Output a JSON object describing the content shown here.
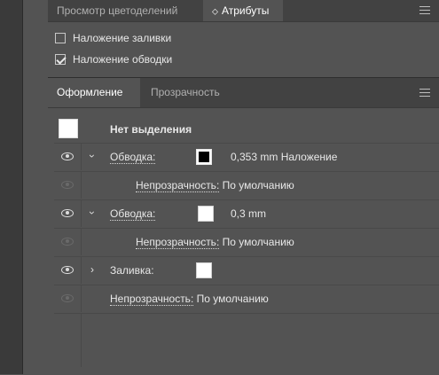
{
  "top_panel": {
    "tabs": [
      {
        "label": "Просмотр цветоделений",
        "active": false
      },
      {
        "label": "Атрибуты",
        "active": true
      }
    ],
    "active_tab_prefix": "⬦",
    "checkboxes": [
      {
        "label": "Наложение заливки",
        "checked": false
      },
      {
        "label": "Наложение обводки",
        "checked": true
      }
    ]
  },
  "appearance_panel": {
    "tabs": [
      {
        "label": "Оформление",
        "active": true
      },
      {
        "label": "Прозрачность",
        "active": false
      }
    ],
    "header": {
      "label": "Нет выделения"
    },
    "rows": [
      {
        "type": "stroke",
        "label": "Обводка:",
        "value": "0,353 mm Наложение",
        "swatch": "black-stroke"
      },
      {
        "type": "opacity",
        "label": "Непрозрачность:",
        "value": "По умолчанию"
      },
      {
        "type": "stroke",
        "label": "Обводка:",
        "value": "0,3 mm",
        "swatch": "white"
      },
      {
        "type": "opacity",
        "label": "Непрозрачность:",
        "value": "По умолчанию"
      },
      {
        "type": "fill",
        "label": "Заливка:",
        "swatch": "white"
      },
      {
        "type": "opacity",
        "label": "Непрозрачность:",
        "value": "По умолчанию"
      }
    ]
  },
  "colors": {
    "panel_bg": "#535353",
    "tabbar_bg": "#424242",
    "text": "#e8e8e8"
  }
}
